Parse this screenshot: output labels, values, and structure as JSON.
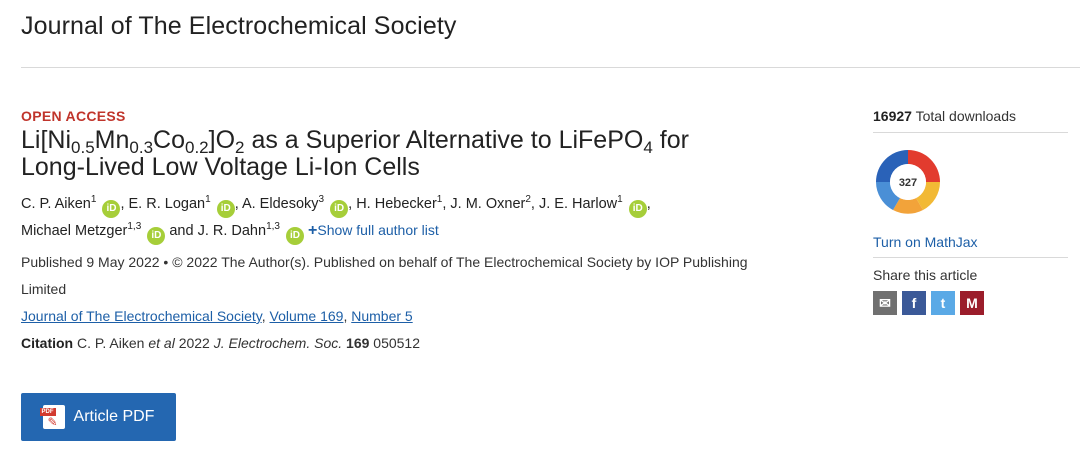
{
  "journal_title": "Journal of The Electrochemical Society",
  "open_access": "OPEN ACCESS",
  "title": {
    "part1": "Li[Ni",
    "sub1": "0.5",
    "part2": "Mn",
    "sub2": "0.3",
    "part3": "Co",
    "sub3": "0.2",
    "part4": "]O",
    "sub4": "2",
    "part5": " as a Superior Alternative to LiFePO",
    "sub5": "4",
    "part6": " for",
    "line2": "Long-Lived Low Voltage Li-Ion Cells"
  },
  "authors": [
    {
      "name": "C. P. Aiken",
      "aff": "1",
      "orcid": true
    },
    {
      "name": "E. R. Logan",
      "aff": "1",
      "orcid": true
    },
    {
      "name": "A. Eldesoky",
      "aff": "3",
      "orcid": true
    },
    {
      "name": "H. Hebecker",
      "aff": "1",
      "orcid": false
    },
    {
      "name": "J. M. Oxner",
      "aff": "2",
      "orcid": false
    },
    {
      "name": "J. E. Harlow",
      "aff": "1",
      "orcid": true
    },
    {
      "name": "Michael Metzger",
      "aff": "1,3",
      "orcid": true
    },
    {
      "name": "J. R. Dahn",
      "aff": "1,3",
      "orcid": true
    }
  ],
  "orcid_label": "iD",
  "sep_comma": ", ",
  "sep_and": " and ",
  "show_authors_plus": "+",
  "show_authors": "Show full author list",
  "published": "Published 9 May 2022 • © 2022 The Author(s). Published on behalf of The Electrochemical Society by IOP Publishing",
  "published_line2": "Limited",
  "journal_link": "Journal of The Electrochemical Society",
  "sep_volume": ", ",
  "volume_link": "Volume 169",
  "sep_number": ", ",
  "number_link": "Number 5",
  "citation": {
    "label": "Citation",
    "authors": " C. P. Aiken ",
    "etal": "et al",
    "year": " 2022 ",
    "journal": "J. Electrochem. Soc.",
    "space": " ",
    "volume": "169",
    "article": " 050512"
  },
  "pdf_button": "Article PDF",
  "pdf_tag": "PDF",
  "sidebar": {
    "downloads_count": "16927",
    "downloads_label": " Total downloads",
    "altmetric_score": "327",
    "mathjax": "Turn on MathJax",
    "share_label": "Share this article",
    "share_icons": [
      "mail-icon",
      "facebook-icon",
      "twitter-icon",
      "mendeley-icon"
    ],
    "share_glyphs": {
      "mail": "✉",
      "facebook": "f",
      "twitter": "t",
      "mendeley": "M"
    }
  },
  "colors": {
    "open_access": "#c0342b",
    "link": "#1d5fa7",
    "pdf_button": "#2467b1",
    "orcid": "#a6ce39"
  }
}
